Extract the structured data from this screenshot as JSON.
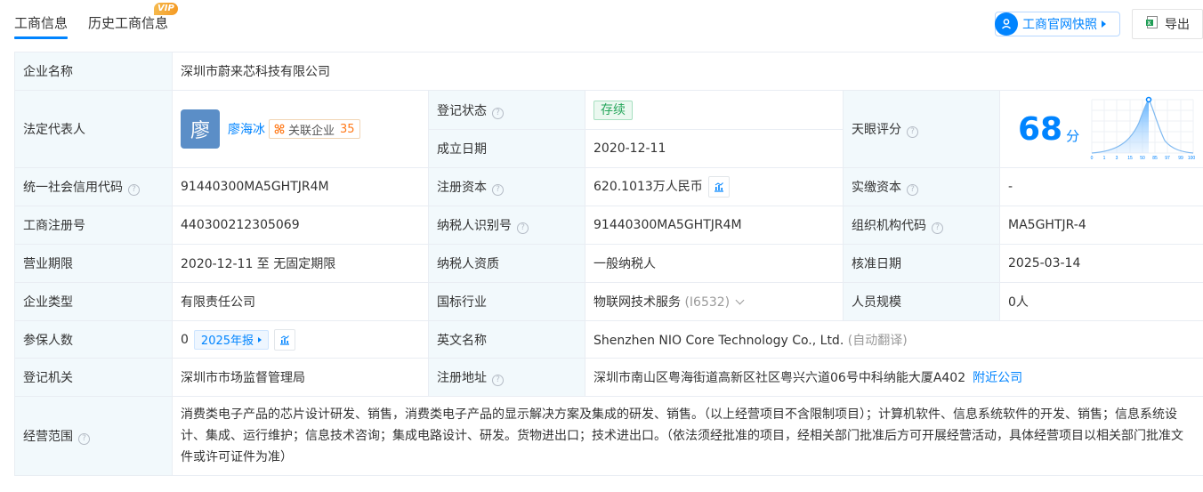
{
  "tabs": {
    "business_info": "工商信息",
    "history_info": "历史工商信息",
    "vip_badge": "VIP"
  },
  "toolbar": {
    "snapshot_label": "工商官网快照",
    "export_label": "导出"
  },
  "company": {
    "name_label": "企业名称",
    "name": "深圳市蔚来芯科技有限公司",
    "legal_rep_label": "法定代表人",
    "legal_rep_avatar": "廖",
    "legal_rep_name": "廖海冰",
    "related_label": "关联企业",
    "related_count": "35",
    "status_label": "登记状态",
    "status": "存续",
    "founded_label": "成立日期",
    "founded": "2020-12-11",
    "score_label": "天眼评分",
    "score": "68",
    "score_unit": "分",
    "score_axis": [
      "0",
      "1",
      "3",
      "15",
      "50",
      "85",
      "97",
      "99",
      "100"
    ],
    "credit_code_label": "统一社会信用代码",
    "credit_code": "91440300MA5GHTJR4M",
    "reg_capital_label": "注册资本",
    "reg_capital": "620.1013万人民币",
    "paid_capital_label": "实缴资本",
    "paid_capital": "-",
    "reg_no_label": "工商注册号",
    "reg_no": "440300212305069",
    "taxpayer_id_label": "纳税人识别号",
    "taxpayer_id": "91440300MA5GHTJR4M",
    "org_code_label": "组织机构代码",
    "org_code": "MA5GHTJR-4",
    "term_label": "营业期限",
    "term": "2020-12-11 至 无固定期限",
    "taxpayer_qual_label": "纳税人资质",
    "taxpayer_qual": "一般纳税人",
    "approval_date_label": "核准日期",
    "approval_date": "2025-03-14",
    "type_label": "企业类型",
    "type": "有限责任公司",
    "industry_label": "国标行业",
    "industry": "物联网技术服务",
    "industry_code": "(I6532)",
    "staff_size_label": "人员规模",
    "staff_size": "0人",
    "insured_label": "参保人数",
    "insured": "0",
    "report_year": "2025年报",
    "english_name_label": "英文名称",
    "english_name": "Shenzhen NIO Core Technology Co., Ltd.",
    "english_name_note": "(自动翻译)",
    "authority_label": "登记机关",
    "authority": "深圳市市场监督管理局",
    "address_label": "注册地址",
    "address": "深圳市南山区粤海街道高新区社区粤兴六道06号中科纳能大厦A402",
    "nearby_link": "附近公司",
    "scope_label": "经营范围",
    "scope": "消费类电子产品的芯片设计研发、销售，消费类电子产品的显示解决方案及集成的研发、销售。（以上经营项目不含限制项目）；计算机软件、信息系统软件的开发、销售；信息系统设计、集成、运行维护；信息技术咨询；集成电路设计、研发。货物进出口；技术进出口。（依法须经批准的项目，经相关部门批准后方可开展经营活动，具体经营项目以相关部门批准文件或许可证件为准）"
  },
  "colors": {
    "accent": "#0084ff",
    "label_bg": "#f2f9fc",
    "active_green": "#26a65b",
    "related_orange": "#ff7a1a"
  }
}
